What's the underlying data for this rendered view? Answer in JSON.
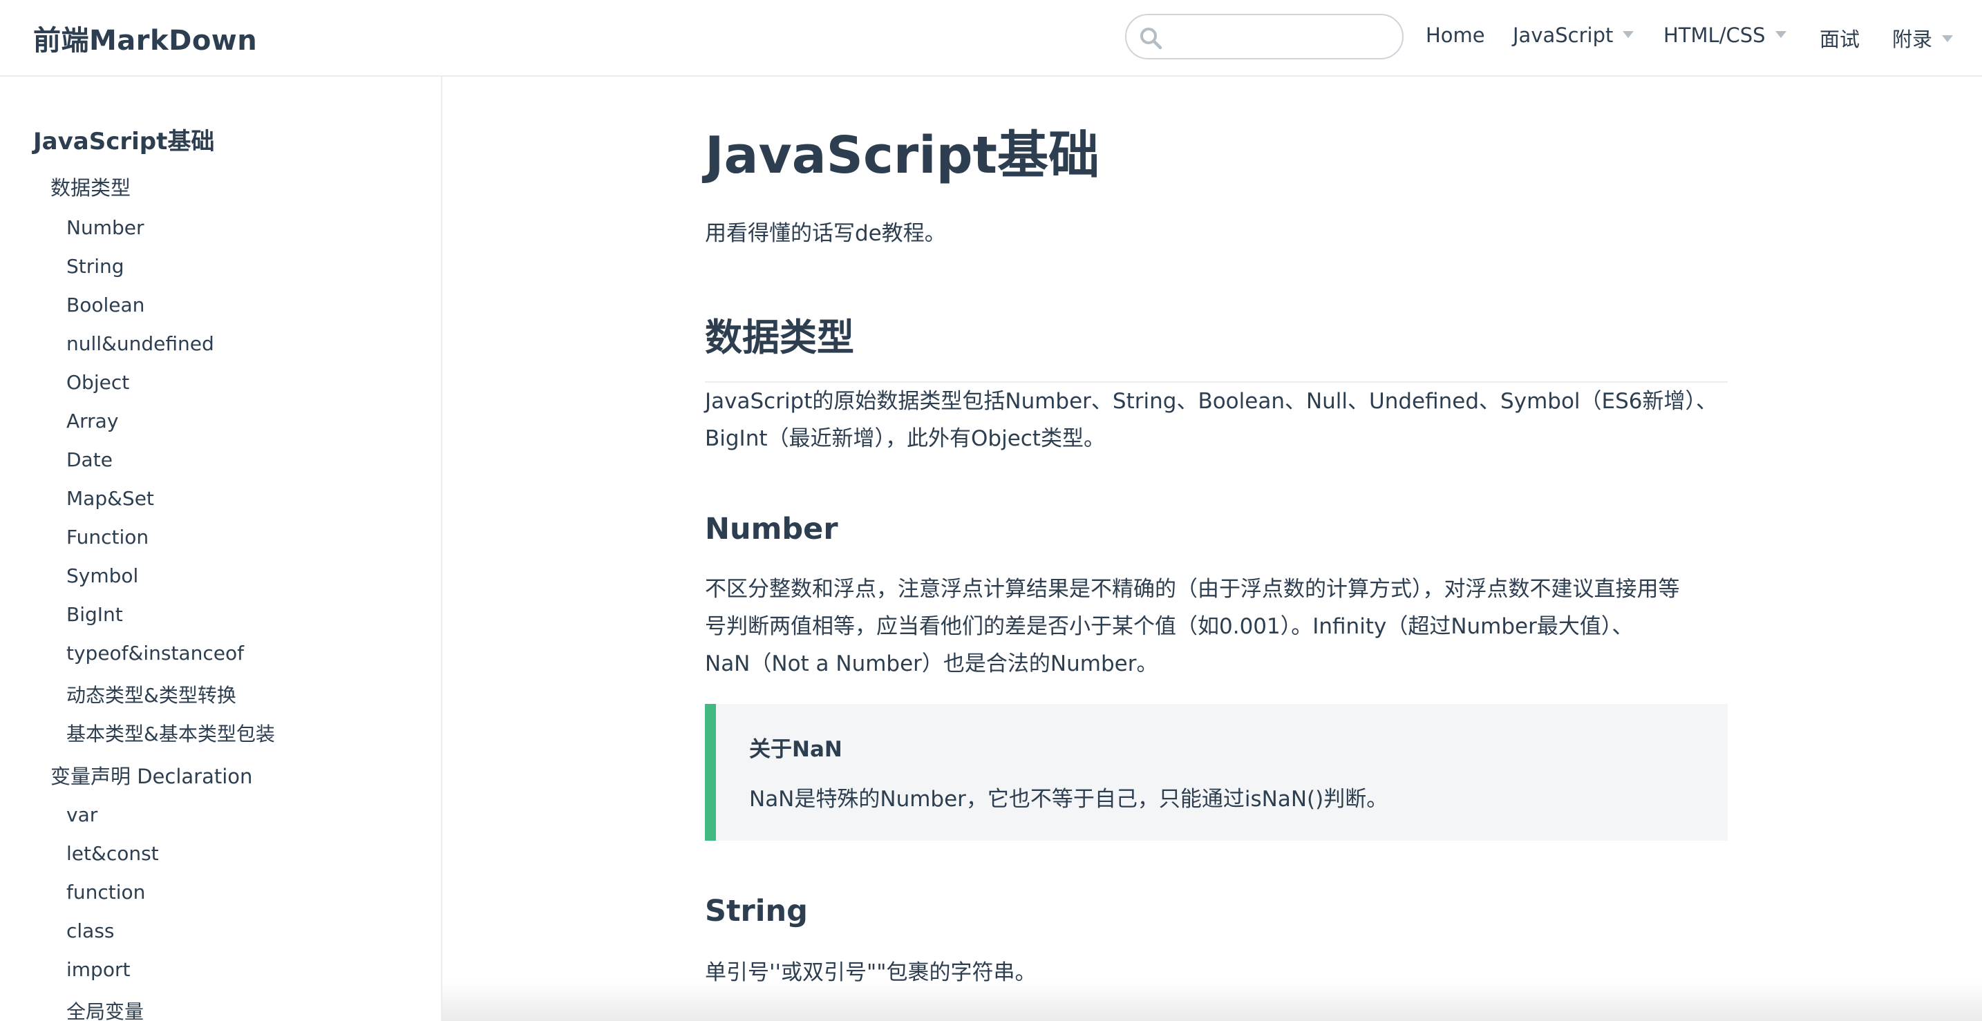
{
  "navbar": {
    "site_name": "前端MarkDown",
    "search": {
      "value": "",
      "icon": "search-icon"
    },
    "links": [
      {
        "label": "Home",
        "dropdown": false
      },
      {
        "label": "JavaScript",
        "dropdown": true
      },
      {
        "label": "HTML/CSS",
        "dropdown": true
      },
      {
        "label": "面试",
        "dropdown": false
      },
      {
        "label": "附录",
        "dropdown": true
      }
    ]
  },
  "sidebar": {
    "heading": "JavaScript基础",
    "groups": [
      {
        "label": "数据类型",
        "items": [
          "Number",
          "String",
          "Boolean",
          "null&undefined",
          "Object",
          "Array",
          "Date",
          "Map&Set",
          "Function",
          "Symbol",
          "BigInt",
          "typeof&instanceof",
          "动态类型&类型转换",
          "基本类型&基本类型包装"
        ]
      },
      {
        "label": "变量声明 Declaration",
        "items": [
          "var",
          "let&const",
          "function",
          "class",
          "import",
          "全局变量"
        ]
      }
    ]
  },
  "main": {
    "title": "JavaScript基础",
    "intro": "用看得懂的话写de教程。",
    "section_title": "数据类型",
    "section_text_line1": "JavaScript的原始数据类型包括Number、String、Boolean、Null、Undefined、Symbol（ES6新增）、",
    "section_text_line2": "BigInt（最近新增），此外有Object类型。",
    "number_title": "Number",
    "number_text_line1": "不区分整数和浮点，注意浮点计算结果是不精确的（由于浮点数的计算方式），对浮点数不建议直接用等",
    "number_text_line2": "号判断两值相等，应当看他们的差是否小于某个值（如0.001）。Infinity（超过Number最大值）、",
    "number_text_line3": "NaN（Not a Number）也是合法的Number。",
    "tip_title": "关于NaN",
    "tip_text": "NaN是特殊的Number，它也不等于自己，只能通过isNaN()判断。",
    "string_title": "String",
    "string_text": "单引号''或双引号\"\"包裹的字符串。"
  },
  "colors": {
    "accent": "#42b983",
    "text": "#2c3e50",
    "tip_bg": "#f3f5f7",
    "border": "#eaecef"
  }
}
